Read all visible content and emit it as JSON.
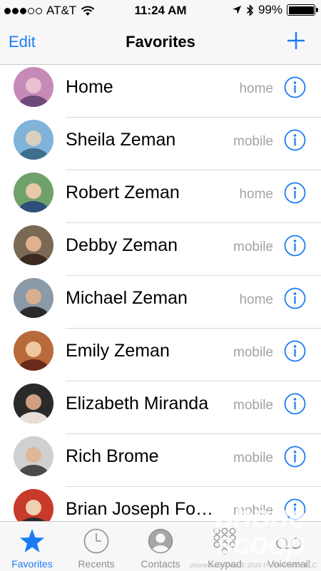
{
  "status_bar": {
    "carrier": "AT&T",
    "time": "11:24 AM",
    "battery": "99%",
    "signal_bars_filled": 3,
    "signal_bars_total": 5
  },
  "nav": {
    "edit": "Edit",
    "title": "Favorites",
    "add_icon": "plus-icon"
  },
  "favorites": [
    {
      "name": "Home",
      "label": "home"
    },
    {
      "name": "Sheila Zeman",
      "label": "mobile"
    },
    {
      "name": "Robert Zeman",
      "label": "home"
    },
    {
      "name": "Debby Zeman",
      "label": "mobile"
    },
    {
      "name": "Michael Zeman",
      "label": "home"
    },
    {
      "name": "Emily Zeman",
      "label": "mobile"
    },
    {
      "name": "Elizabeth Miranda",
      "label": "mobile"
    },
    {
      "name": "Rich Brome",
      "label": "mobile"
    },
    {
      "name": "Brian Joseph Fo…",
      "label": "mobile"
    }
  ],
  "tabs": [
    {
      "label": "Favorites",
      "icon": "star-icon",
      "active": true
    },
    {
      "label": "Recents",
      "icon": "clock-icon",
      "active": false
    },
    {
      "label": "Contacts",
      "icon": "contact-icon",
      "active": false
    },
    {
      "label": "Keypad",
      "icon": "keypad-icon",
      "active": false
    },
    {
      "label": "Voicemail",
      "icon": "voicemail-icon",
      "active": false
    }
  ],
  "watermark": {
    "logo_line1": "phone",
    "logo_line2": "scoop",
    "text": "phonescoop.com © 2024 Phone Factor, LLC"
  },
  "colors": {
    "accent": "#1a7cf5",
    "secondary_text": "#a3a3a8",
    "bar_background": "#f7f7f8"
  }
}
